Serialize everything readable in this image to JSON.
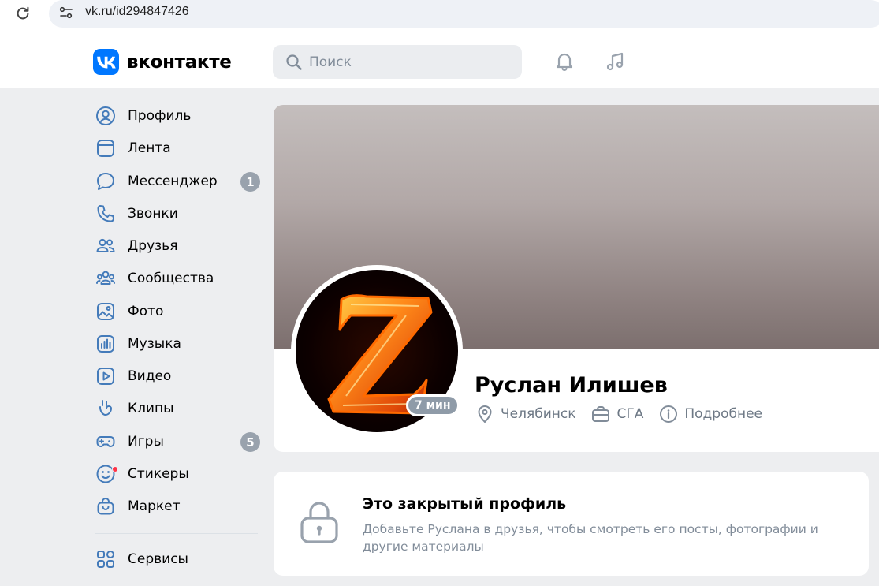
{
  "browser": {
    "url": "vk.ru/id294847426",
    "reload_icon": "reload-icon",
    "site_info_icon": "site-settings-icon"
  },
  "header": {
    "logo_text": "вконтакте",
    "search_placeholder": "Поиск",
    "icons": [
      "bell-icon",
      "music-note-icon"
    ]
  },
  "sidebar": {
    "items": [
      {
        "label": "Профиль",
        "icon": "user-circle-icon"
      },
      {
        "label": "Лента",
        "icon": "newsfeed-icon"
      },
      {
        "label": "Мессенджер",
        "icon": "message-bubble-icon",
        "badge": "1"
      },
      {
        "label": "Звонки",
        "icon": "phone-icon"
      },
      {
        "label": "Друзья",
        "icon": "friends-icon"
      },
      {
        "label": "Сообщества",
        "icon": "communities-icon"
      },
      {
        "label": "Фото",
        "icon": "photo-icon"
      },
      {
        "label": "Музыка",
        "icon": "music-icon"
      },
      {
        "label": "Видео",
        "icon": "video-icon"
      },
      {
        "label": "Клипы",
        "icon": "clips-icon"
      },
      {
        "label": "Игры",
        "icon": "gamepad-icon",
        "badge": "5"
      },
      {
        "label": "Стикеры",
        "icon": "smile-icon",
        "dot": true
      },
      {
        "label": "Маркет",
        "icon": "shopping-bag-icon"
      },
      {
        "label": "Сервисы",
        "icon": "services-grid-icon"
      }
    ]
  },
  "profile": {
    "name": "Руслан Илишев",
    "online_badge": "7 мин",
    "city": "Челябинск",
    "education": "СГА",
    "more_label": "Подробнее"
  },
  "closed_profile": {
    "title": "Это закрытый профиль",
    "description": "Добавьте Руслана в друзья, чтобы смотреть его посты, фотографии и другие материалы"
  },
  "colors": {
    "accent": "#0077ff",
    "nav_icon": "#447bba",
    "badge": "#99a2ad",
    "secondary_text": "#818c99",
    "page_bg": "#edeef0"
  }
}
